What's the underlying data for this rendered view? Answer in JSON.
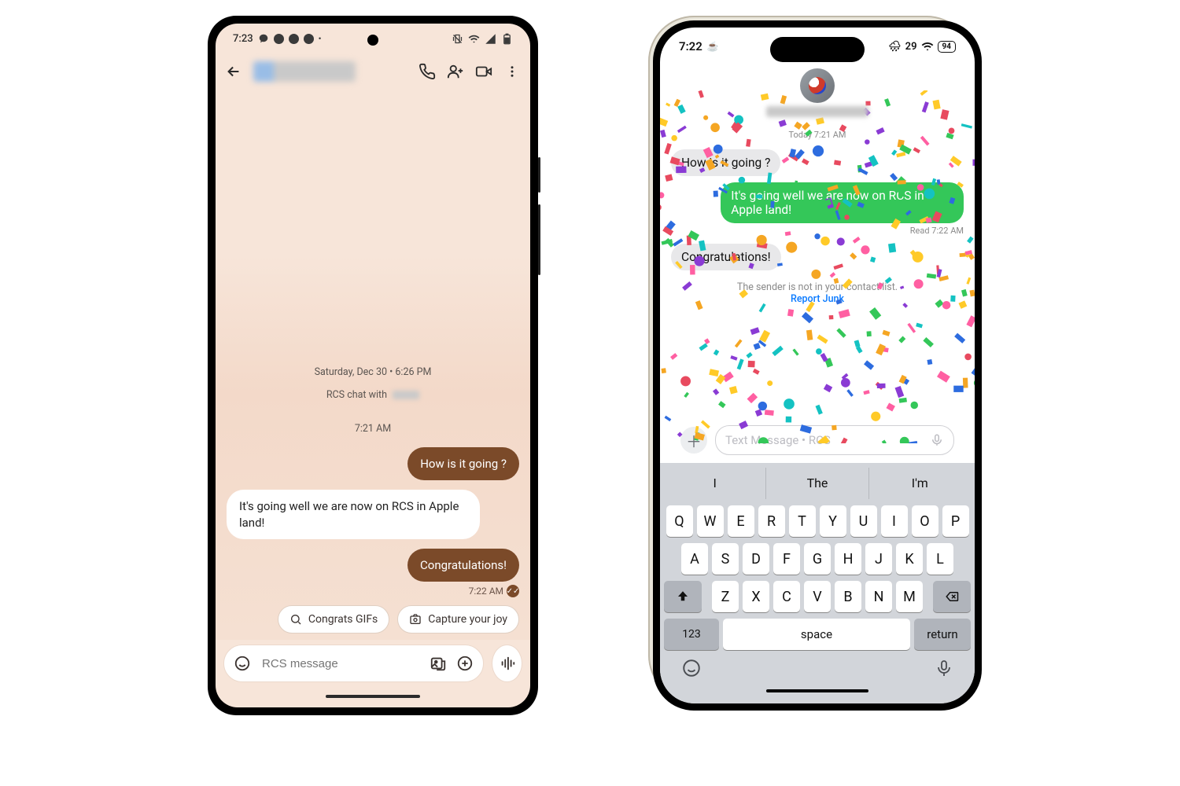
{
  "android": {
    "status": {
      "time": "7:23"
    },
    "meta": {
      "date_line": "Saturday, Dec 30 • 6:26 PM",
      "rcs_line": "RCS chat with",
      "time2": "7:21 AM"
    },
    "messages": {
      "m1": "How is it going ?",
      "m2": "It's going well we are now on RCS in Apple land!",
      "m3": "Congratulations!"
    },
    "read": {
      "time": "7:22 AM"
    },
    "chips": {
      "gifs": "Congrats GIFs",
      "capture": "Capture your joy"
    },
    "compose": {
      "placeholder": "RCS message"
    }
  },
  "ios": {
    "status": {
      "time": "7:22",
      "temp": "29",
      "battery": "94"
    },
    "meta": {
      "today": "Today 7:21 AM"
    },
    "messages": {
      "m1": "How is it going ?",
      "m2": "It's going well we are now on RCS in Apple land!",
      "m3": "Congratulations!"
    },
    "read": "Read 7:22 AM",
    "junk": {
      "line": "The sender is not in your contact list.",
      "link": "Report Junk"
    },
    "compose": {
      "placeholder": "Text Message • RCS"
    },
    "suggestions": {
      "s1": "I",
      "s2": "The",
      "s3": "I'm"
    },
    "keys": {
      "r1": [
        "Q",
        "W",
        "E",
        "R",
        "T",
        "Y",
        "U",
        "I",
        "O",
        "P"
      ],
      "r2": [
        "A",
        "S",
        "D",
        "F",
        "G",
        "H",
        "J",
        "K",
        "L"
      ],
      "r3": [
        "Z",
        "X",
        "C",
        "V",
        "B",
        "N",
        "M"
      ],
      "n123": "123",
      "space": "space",
      "ret": "return"
    }
  }
}
